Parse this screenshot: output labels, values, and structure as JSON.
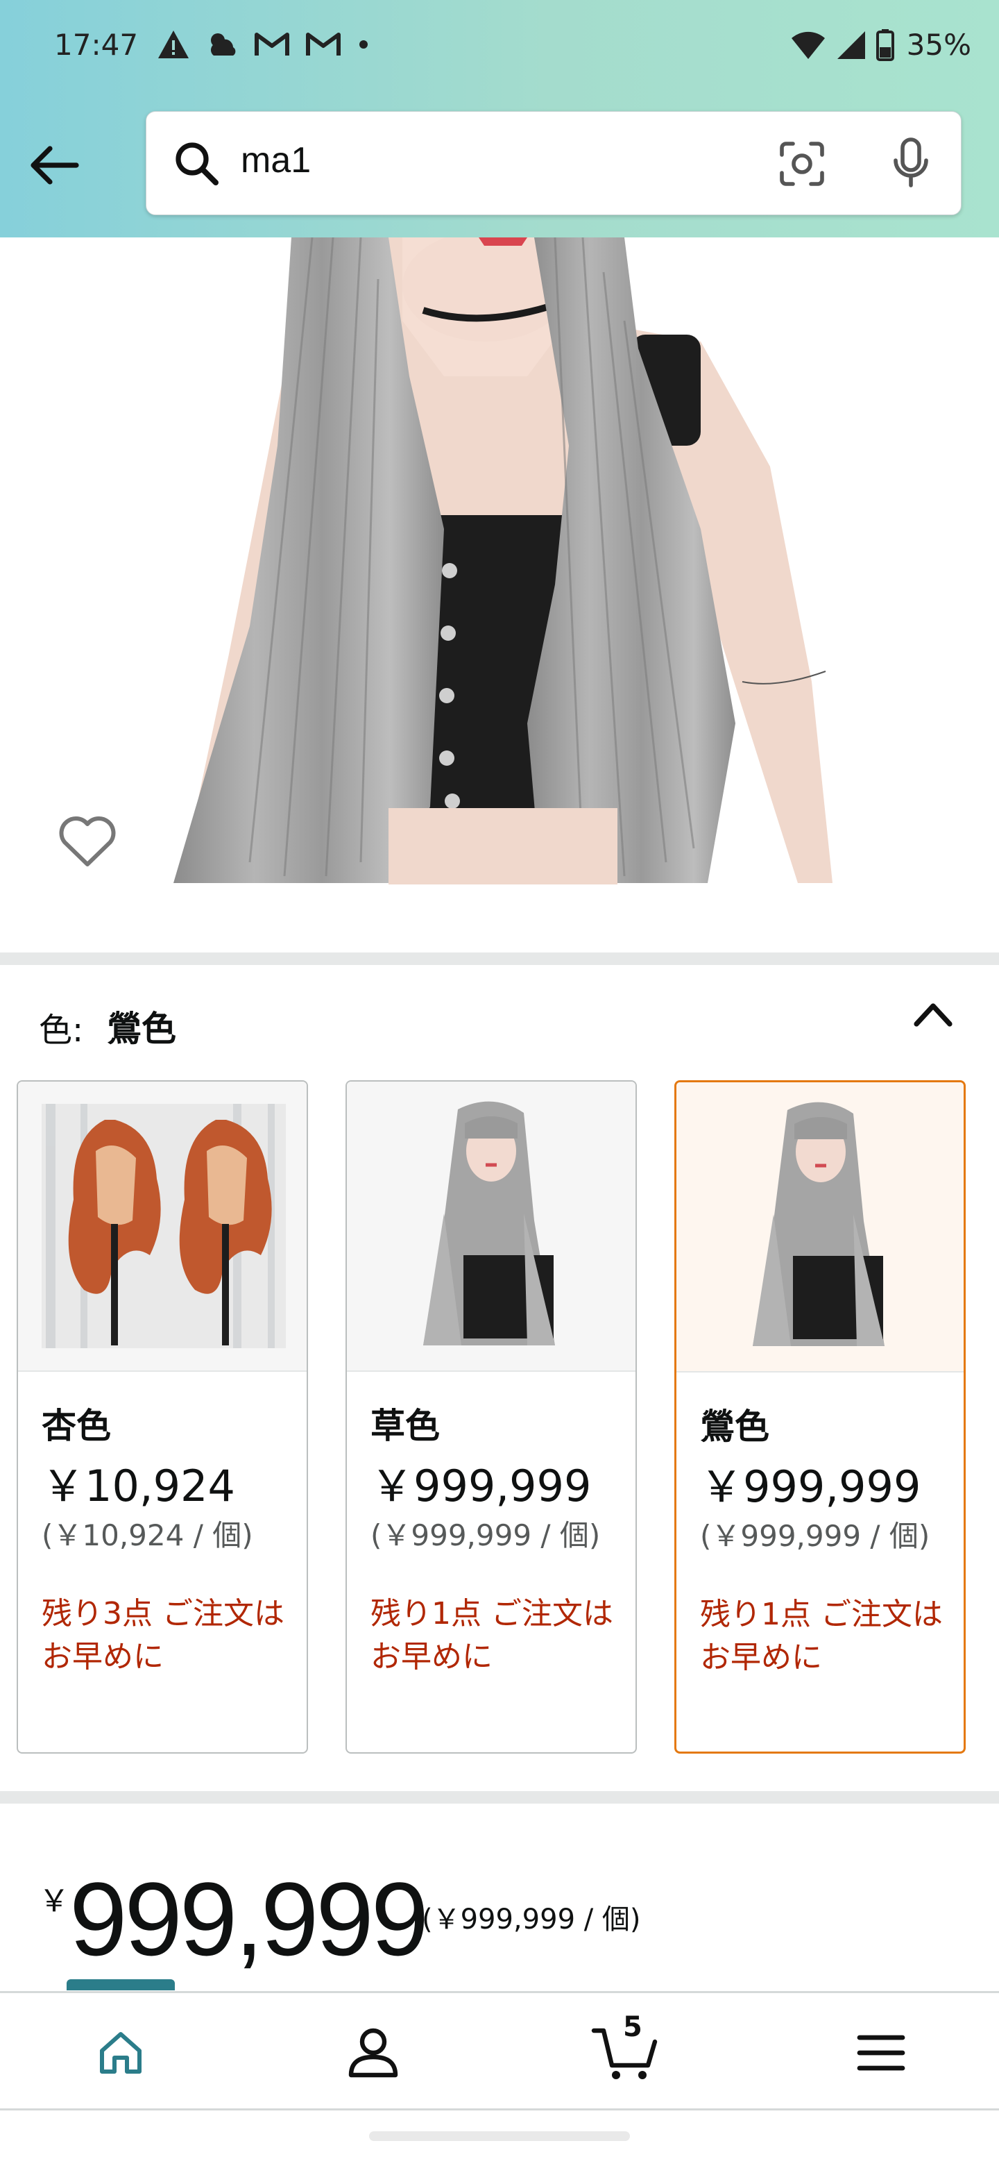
{
  "status_bar": {
    "time": "17:47",
    "battery": "35%",
    "icons_left": [
      "warning-icon",
      "weather-icon",
      "gmail-icon",
      "gmail-icon",
      "dot-icon"
    ],
    "icons_right": [
      "wifi-icon",
      "signal-icon",
      "battery-icon"
    ]
  },
  "search": {
    "query": "ma1",
    "icons": [
      "search-icon",
      "camera-lens-icon",
      "microphone-icon"
    ]
  },
  "colors": {
    "header_gradient_start": "#86d0da",
    "header_gradient_end": "#a9e3cf",
    "selected_border": "#e47911",
    "stock_warning": "#b12704",
    "nav_accent": "#2b7d8a"
  },
  "variation": {
    "label": "色:",
    "selected": "鶯色",
    "options": [
      {
        "name": "杏色",
        "price": "￥10,924",
        "unit_price": "(￥10,924 / 個)",
        "stock": "残り3点 ご注文はお早めに",
        "selected": false
      },
      {
        "name": "草色",
        "price": "￥999,999",
        "unit_price": "(￥999,999 / 個)",
        "stock": "残り1点 ご注文はお早めに",
        "selected": false
      },
      {
        "name": "鶯色",
        "price": "￥999,999",
        "unit_price": "(￥999,999 / 個)",
        "stock": "残り1点 ご注文はお早めに",
        "selected": true
      }
    ]
  },
  "price": {
    "symbol": "￥",
    "amount": "999,999",
    "unit": "(￥999,999 / 個)"
  },
  "bottom_nav": {
    "items": [
      "home-icon",
      "account-icon",
      "cart-icon",
      "menu-icon"
    ],
    "cart_count": "5",
    "active": "home"
  }
}
